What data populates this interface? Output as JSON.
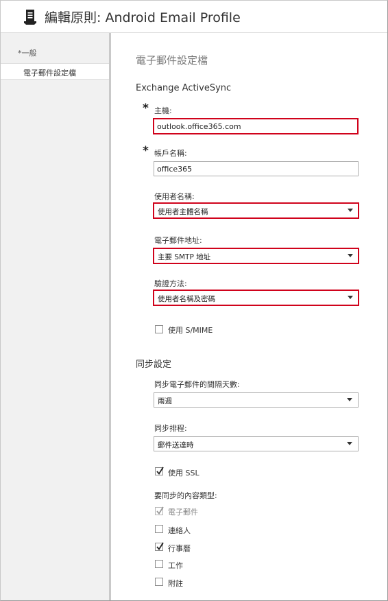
{
  "header": {
    "title": "編輯原則: Android Email Profile",
    "icon": "policy-document-icon"
  },
  "sidebar": {
    "items": [
      {
        "label": "*一般",
        "active": false
      },
      {
        "label": "電子郵件設定檔",
        "active": true
      }
    ]
  },
  "main": {
    "heading": "電子郵件設定檔",
    "exchange": {
      "title": "Exchange ActiveSync",
      "required_marker": "*",
      "host": {
        "label": "主機:",
        "value": "outlook.office365.com"
      },
      "account": {
        "label": "帳戶名稱:",
        "value": "office365"
      },
      "username": {
        "label": "使用者名稱:",
        "value": "使用者主體名稱"
      },
      "email": {
        "label": "電子郵件地址:",
        "value": "主要 SMTP 地址"
      },
      "auth": {
        "label": "驗證方法:",
        "value": "使用者名稱及密碼"
      },
      "smime": {
        "label": "使用 S/MIME",
        "checked": false
      }
    },
    "sync": {
      "title": "同步設定",
      "interval": {
        "label": "同步電子郵件的間隔天數:",
        "value": "兩週"
      },
      "schedule": {
        "label": "同步排程:",
        "value": "郵件送達時"
      },
      "ssl": {
        "label": "使用 SSL",
        "checked": true
      },
      "content_types_label": "要同步的內容類型:",
      "content_types": [
        {
          "label": "電子郵件",
          "checked": true,
          "disabled": true
        },
        {
          "label": "連絡人",
          "checked": false,
          "disabled": false
        },
        {
          "label": "行事曆",
          "checked": true,
          "disabled": false
        },
        {
          "label": "工作",
          "checked": false,
          "disabled": false
        },
        {
          "label": "附註",
          "checked": false,
          "disabled": false
        }
      ]
    }
  },
  "colors": {
    "highlight": "#d0021b",
    "sidebar_bg": "#f1f1f1"
  }
}
